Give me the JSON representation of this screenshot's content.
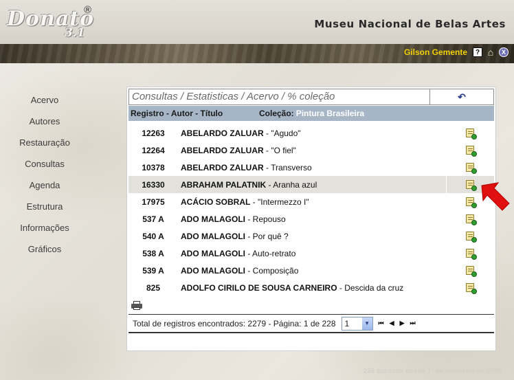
{
  "header": {
    "logo_text": "Donato",
    "logo_version": "3.1",
    "logo_reg": "®",
    "museum_title": "Museu Nacional de Belas Artes",
    "user_name": "Gilson Gemente",
    "help_label": "?",
    "logout_label": "X"
  },
  "sidebar": {
    "items": [
      {
        "label": "Acervo"
      },
      {
        "label": "Autores"
      },
      {
        "label": "Restauração"
      },
      {
        "label": "Consultas"
      },
      {
        "label": "Agenda"
      },
      {
        "label": "Estrutura"
      },
      {
        "label": "Informações"
      },
      {
        "label": "Gráficos"
      }
    ]
  },
  "panel": {
    "breadcrumb": "Consultas / Estatisticas / Acervo / % coleção",
    "back_icon": "↶",
    "column_header": "Registro - Autor - Título",
    "colecao_label": "Coleção:",
    "colecao_value": "Pintura Brasileira",
    "rows": [
      {
        "reg": "12263",
        "author": "ABELARDO ZALUAR",
        "title": " - \"Agudo\""
      },
      {
        "reg": "12264",
        "author": "ABELARDO ZALUAR",
        "title": " - \"O fiel\""
      },
      {
        "reg": "10378",
        "author": "ABELARDO ZALUAR",
        "title": " - Transverso"
      },
      {
        "reg": "16330",
        "author": "ABRAHAM PALATNIK",
        "title": " - Aranha azul"
      },
      {
        "reg": "17975",
        "author": "ACÁCIO SOBRAL",
        "title": " - \"Intermezzo I\""
      },
      {
        "reg": "537 A",
        "author": "ADO MALAGOLI",
        "title": " - Repouso"
      },
      {
        "reg": "540 A",
        "author": "ADO MALAGOLI",
        "title": " - Por quê ?"
      },
      {
        "reg": "538 A",
        "author": "ADO MALAGOLI",
        "title": " - Auto-retrato"
      },
      {
        "reg": "539 A",
        "author": "ADO MALAGOLI",
        "title": " - Composição"
      },
      {
        "reg": "825",
        "author": "ADOLFO CIRILO DE SOUSA CARNEIRO",
        "title": " - Descida da cruz"
      }
    ],
    "highlighted_row": 3,
    "pager": {
      "total_text": "Total de registros encontrados: 2279 - Página: 1 de 228",
      "page_value": "1",
      "nav": [
        "⏮",
        "◀",
        "▶",
        "⏭"
      ]
    }
  },
  "footer": {
    "text": "239 acessos desde 1º de fevereiro de 2008"
  },
  "colors": {
    "header_bar": "#a6b6c6",
    "colecao_value": "#ffffff",
    "user_name": "#f2d200",
    "arrow": "#e01010",
    "highlight_row": "#e3e1dc"
  }
}
